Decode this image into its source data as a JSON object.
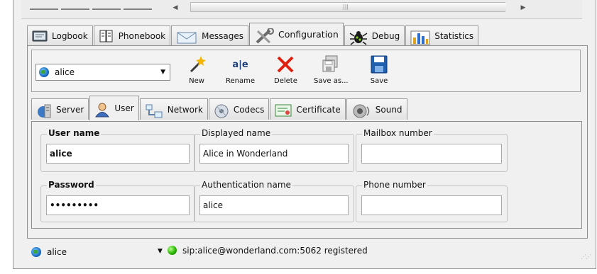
{
  "main_tabs": [
    {
      "label": "Logbook",
      "icon": "logbook-icon"
    },
    {
      "label": "Phonebook",
      "icon": "phonebook-icon"
    },
    {
      "label": "Messages",
      "icon": "messages-icon"
    },
    {
      "label": "Configuration",
      "icon": "configuration-icon",
      "active": true
    },
    {
      "label": "Debug",
      "icon": "debug-icon"
    },
    {
      "label": "Statistics",
      "icon": "statistics-icon"
    }
  ],
  "account_selector": {
    "value": "alice"
  },
  "toolbar": {
    "new_label": "New",
    "rename_label": "Rename",
    "rename_glyph": "a|e",
    "delete_label": "Delete",
    "save_as_label": "Save as...",
    "save_label": "Save"
  },
  "sub_tabs": [
    {
      "label": "Server",
      "icon": "server-icon"
    },
    {
      "label": "User",
      "icon": "user-icon",
      "active": true
    },
    {
      "label": "Network",
      "icon": "network-icon"
    },
    {
      "label": "Codecs",
      "icon": "codecs-icon"
    },
    {
      "label": "Certificate",
      "icon": "certificate-icon"
    },
    {
      "label": "Sound",
      "icon": "sound-icon"
    }
  ],
  "user_form": {
    "user_name_label": "User name",
    "user_name_value": "alice",
    "displayed_name_label": "Displayed name",
    "displayed_name_value": "Alice in Wonderland",
    "mailbox_label": "Mailbox number",
    "mailbox_value": "",
    "password_label": "Password",
    "password_value": "•••••••••",
    "auth_name_label": "Authentication name",
    "auth_name_value": "alice",
    "phone_label": "Phone number",
    "phone_value": ""
  },
  "status_bar": {
    "account": "alice",
    "registration": "sip:alice@wonderland.com:5062 registered"
  },
  "colors": {
    "delete_red": "#e02010",
    "save_blue": "#1f5fb0",
    "status_green": "#27b600"
  }
}
